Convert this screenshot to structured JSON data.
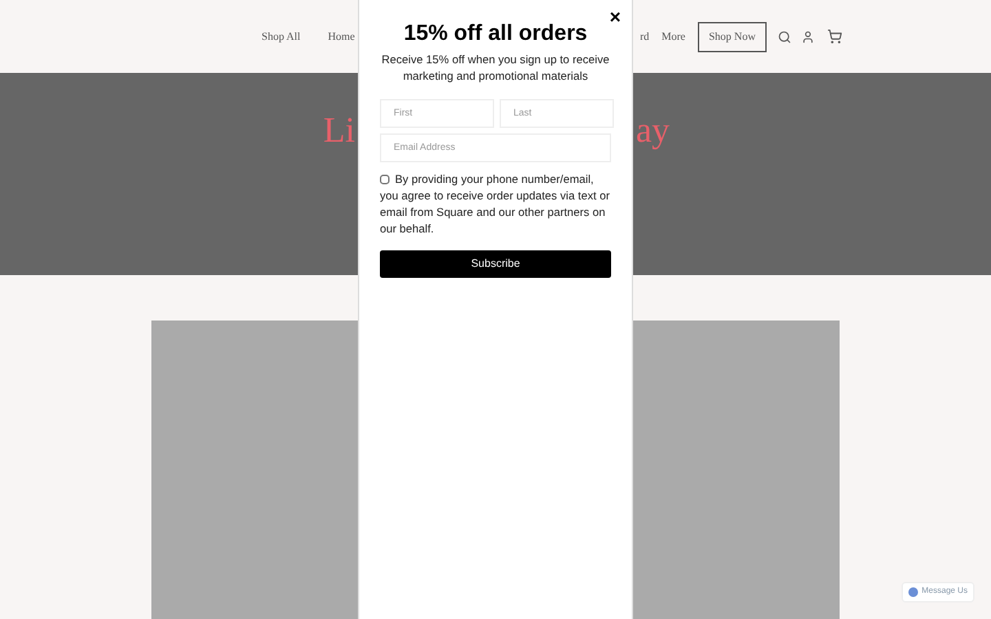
{
  "nav": {
    "items_left": [
      "Shop All",
      "Home"
    ],
    "items_right": [
      "rd",
      "More"
    ],
    "cta": "Shop Now"
  },
  "hero": {
    "title_left": "Li",
    "title_right": "ay"
  },
  "modal": {
    "close": "×",
    "title": "15% off all orders",
    "description": "Receive 15% off when you sign up to receive marketing and promotional materials",
    "fields": [
      {
        "placeholder": "First"
      },
      {
        "placeholder": "Last"
      }
    ],
    "email": {
      "placeholder": "Email Address"
    },
    "consent": {
      "checked": false,
      "text": "By providing your phone number/email, you agree to receive order updates via text or email from Square and our other partners on our behalf."
    },
    "button": "Subscribe"
  },
  "chat": {
    "label": "Message Us"
  }
}
